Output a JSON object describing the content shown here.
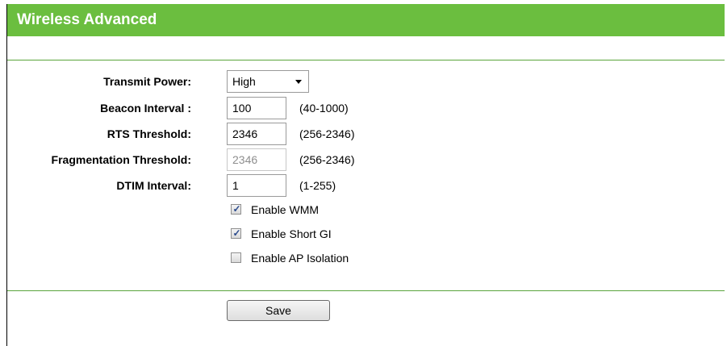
{
  "header": {
    "title": "Wireless Advanced"
  },
  "form": {
    "transmit_power": {
      "label": "Transmit Power:",
      "value": "High"
    },
    "beacon_interval": {
      "label": "Beacon Interval :",
      "value": "100",
      "range": "(40-1000)"
    },
    "rts_threshold": {
      "label": "RTS Threshold:",
      "value": "2346",
      "range": "(256-2346)"
    },
    "fragmentation_threshold": {
      "label": "Fragmentation Threshold:",
      "value": "2346",
      "range": "(256-2346)",
      "disabled": true
    },
    "dtim_interval": {
      "label": "DTIM Interval:",
      "value": "1",
      "range": "(1-255)"
    },
    "checkboxes": [
      {
        "label": "Enable WMM",
        "checked": true
      },
      {
        "label": "Enable Short GI",
        "checked": true
      },
      {
        "label": "Enable AP Isolation",
        "checked": false
      }
    ]
  },
  "actions": {
    "save_label": "Save"
  },
  "colors": {
    "header_bg": "#6bbe3f",
    "divider": "#5aa43c"
  }
}
